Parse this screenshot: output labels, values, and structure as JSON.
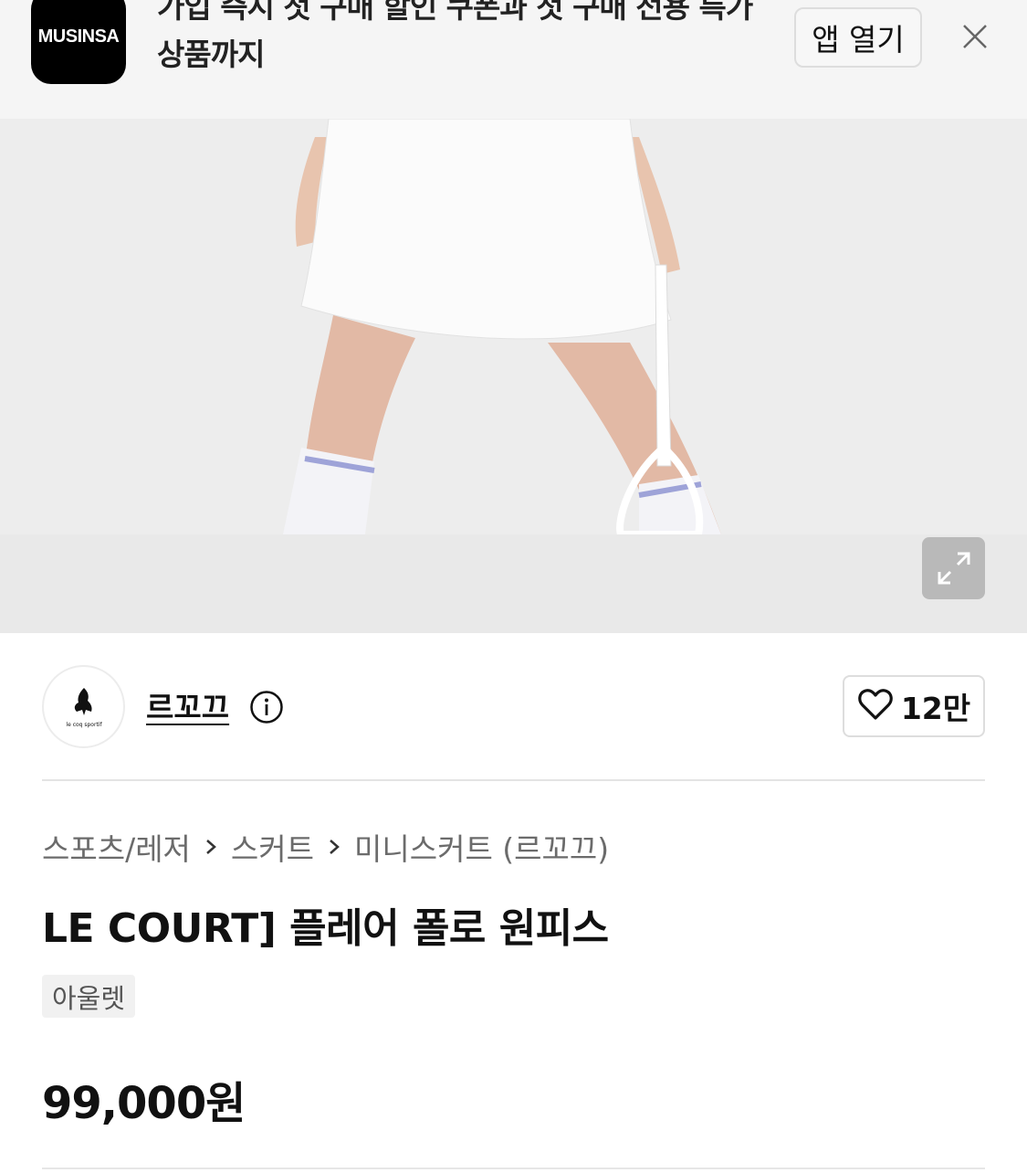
{
  "banner": {
    "logo_text": "MUSINSA",
    "message": "가입 즉시 첫 구매 할인 쿠폰과 첫 구매 전용 특가 상품까지",
    "open_app_label": "앱 열기",
    "close_icon": "close-icon"
  },
  "hero": {
    "expand_icon": "expand-icon"
  },
  "brand": {
    "logo_text": "le coq sportif",
    "name": "르꼬끄",
    "info_icon": "info-icon",
    "like_icon": "heart-icon",
    "like_count": "12만"
  },
  "breadcrumb": {
    "items": [
      "스포츠/레저",
      "스커트",
      "미니스커트 (르꼬끄)"
    ],
    "separator_icon": "chevron-right-icon"
  },
  "product": {
    "title": "LE COURT] 플레어 폴로 원피스",
    "tag": "아울렛",
    "price": "99,000원"
  },
  "colors": {
    "banner_bg": "#f5f5f5",
    "logo_bg": "#000000",
    "hero_bg": "#e9e9e9",
    "text_primary": "#111111",
    "text_secondary": "#6b6b6b",
    "tag_bg": "#f1f1f1"
  }
}
